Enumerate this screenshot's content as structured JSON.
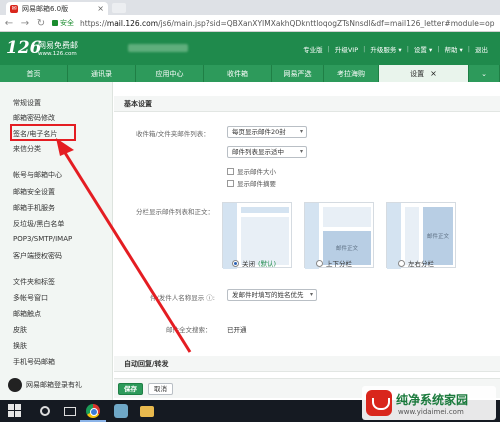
{
  "browser": {
    "tab_title": "网易邮箱6.0版",
    "secure_label": "安全",
    "url_prefix": "https://",
    "url_host": "mail.126.com",
    "url_path": "/js6/main.jsp?sid=QBXanXYIMXakhQDknttloqogZTsNnsdl&df=mail126_letter#module=op"
  },
  "header": {
    "logo_number": "126",
    "logo_text": "网易免费邮",
    "logo_url": "www.126.com",
    "nav": [
      "专业版",
      "升级VIP",
      "升级服务 ▾",
      "设置 ▾",
      "帮助 ▾",
      "退出"
    ]
  },
  "module_tabs": [
    {
      "label": "首页",
      "width": 68
    },
    {
      "label": "通讯录",
      "width": 68
    },
    {
      "label": "应用中心",
      "width": 68
    },
    {
      "label": "收件箱",
      "width": 68
    },
    {
      "label": "网易严选",
      "width": 52
    },
    {
      "label": "考拉海购",
      "width": 55
    },
    {
      "label": "设置",
      "width": 90,
      "active": true
    },
    {
      "label": "",
      "width": 31
    }
  ],
  "sidebar": {
    "items": [
      "常规设置",
      "邮箱密码修改",
      "签名/电子名片",
      "来信分类",
      "帐号与邮箱中心",
      "邮箱安全设置",
      "邮箱手机服务",
      "反垃圾/黑白名单",
      "POP3/SMTP/IMAP",
      "客户端授权密码",
      "文件夹和标签",
      "多帐号窗口",
      "邮箱触点",
      "皮肤",
      "换肤",
      "手机号码邮箱"
    ],
    "notification": "网易邮箱登录有礼"
  },
  "settings": {
    "section_basic": "基本设置",
    "list_label": "收件箱/文件夹邮件列表：",
    "per_page": "每页显示邮件20封",
    "density": "邮件列表显示适中",
    "show_size": "显示邮件大小",
    "show_summary": "显示邮件摘要",
    "split_label": "分栏显示邮件列表和正文：",
    "preview_text": "邮件正文",
    "split_off": "关闭",
    "split_default": "(默认)",
    "split_vertical": "上下分栏",
    "split_horizontal": "左右分栏",
    "sender_label": "件/发件人名称显示",
    "sender_value": "发邮件时填写的姓名优先",
    "search_label": "邮件全文搜索：",
    "search_value": "已开通",
    "section_auto": "自动回复/转发"
  },
  "actions": {
    "save": "保存",
    "cancel": "取消"
  },
  "watermark": {
    "title": "纯净系统家园",
    "url": "www.yidaimei.com"
  },
  "colors": {
    "brand_green": "#1f8a4c",
    "annotation_red": "#e41d22"
  }
}
